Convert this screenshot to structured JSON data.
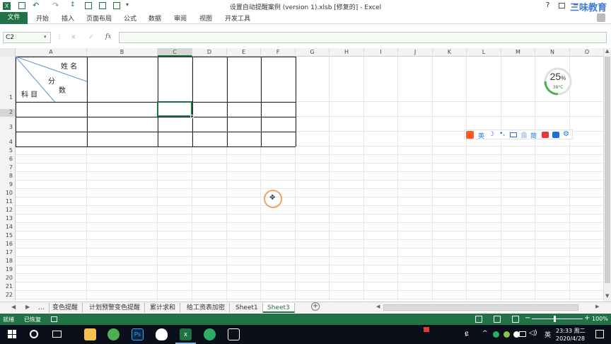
{
  "window": {
    "title": "设置自动提醒案例 (version 1).xlsb [修复的] - Excel",
    "help": "?",
    "watermark": "三味教育"
  },
  "ribbon": {
    "file": "文件",
    "tabs": [
      "开始",
      "插入",
      "页面布局",
      "公式",
      "数据",
      "审阅",
      "视图",
      "开发工具"
    ]
  },
  "formula_bar": {
    "name_box": "C2",
    "fx": "fx",
    "cancel": "✕",
    "enter": "✓",
    "value": ""
  },
  "columns": [
    "A",
    "B",
    "C",
    "D",
    "E",
    "F",
    "G",
    "H",
    "I",
    "J",
    "K",
    "L",
    "M",
    "N",
    "O"
  ],
  "rows": [
    "1",
    "2",
    "3",
    "4",
    "5",
    "6",
    "7",
    "8",
    "9",
    "10",
    "11",
    "12",
    "13",
    "14",
    "15",
    "16",
    "17",
    "18",
    "19",
    "20",
    "21",
    "22"
  ],
  "cell_a1": {
    "name": "姓 名",
    "fen": "分",
    "shu": "数",
    "subject": "科 目"
  },
  "widget": {
    "percent": "25",
    "percent_sign": "%",
    "temp": "38°C",
    "level": 0.25
  },
  "ime_toolbar": {
    "lang": "英",
    "items": [
      "英",
      "☽",
      "•,",
      "⌨",
      "♟",
      "简",
      "🎥",
      "👕",
      "⚙"
    ]
  },
  "sheets": {
    "ellipsis": "...",
    "tabs": [
      "变色提醒",
      "计划预警变色提醒",
      "累计求和",
      "给工资表加密",
      "Sheet1",
      "Sheet3"
    ],
    "active": "Sheet3",
    "add": "+"
  },
  "status": {
    "ready": "就绪",
    "recovered": "已恢复",
    "zoom": "100%"
  },
  "taskbar": {
    "time": "23:33 周二",
    "date": "2020/4/28"
  },
  "colors": {
    "excel_green": "#217346",
    "selection": "#217346",
    "widget_ring": "#4caf50"
  }
}
